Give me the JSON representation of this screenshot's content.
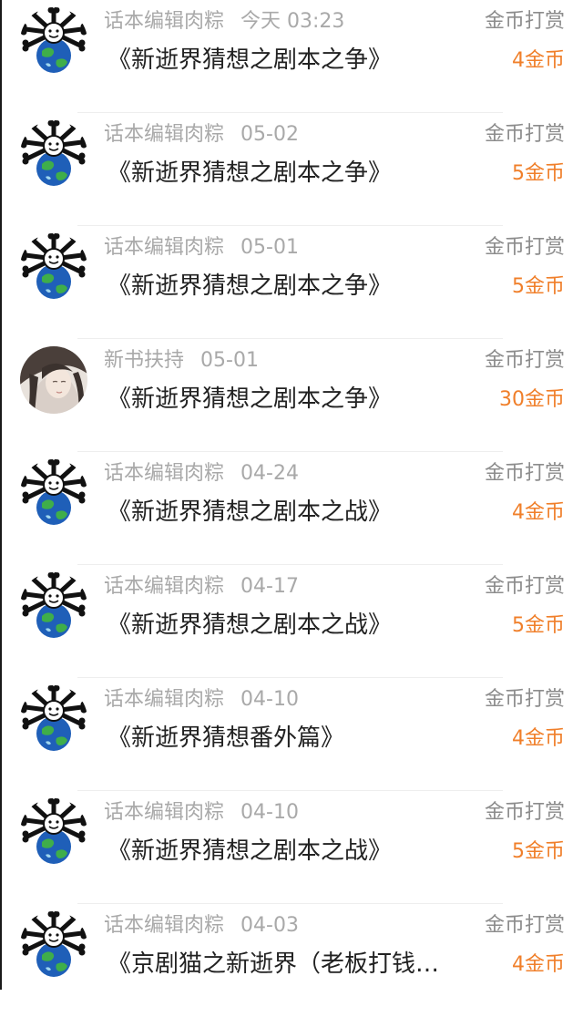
{
  "accent_color": "#f07f2a",
  "records": [
    {
      "user": "话本编辑肉粽",
      "time": "今天 03:23",
      "title": "《新逝界猜想之剧本之争》",
      "type": "金币打赏",
      "amount": "4金币",
      "avatar": "globe-avatar"
    },
    {
      "user": "话本编辑肉粽",
      "time": "05-02",
      "title": "《新逝界猜想之剧本之争》",
      "type": "金币打赏",
      "amount": "5金币",
      "avatar": "globe-avatar"
    },
    {
      "user": "话本编辑肉粽",
      "time": "05-01",
      "title": "《新逝界猜想之剧本之争》",
      "type": "金币打赏",
      "amount": "5金币",
      "avatar": "globe-avatar"
    },
    {
      "user": "新书扶持",
      "time": "05-01",
      "title": "《新逝界猜想之剧本之争》",
      "type": "金币打赏",
      "amount": "30金币",
      "avatar": "portrait-avatar"
    },
    {
      "user": "话本编辑肉粽",
      "time": "04-24",
      "title": "《新逝界猜想之剧本之战》",
      "type": "金币打赏",
      "amount": "4金币",
      "avatar": "globe-avatar"
    },
    {
      "user": "话本编辑肉粽",
      "time": "04-17",
      "title": "《新逝界猜想之剧本之战》",
      "type": "金币打赏",
      "amount": "5金币",
      "avatar": "globe-avatar"
    },
    {
      "user": "话本编辑肉粽",
      "time": "04-10",
      "title": "《新逝界猜想番外篇》",
      "type": "金币打赏",
      "amount": "4金币",
      "avatar": "globe-avatar"
    },
    {
      "user": "话本编辑肉粽",
      "time": "04-10",
      "title": "《新逝界猜想之剧本之战》",
      "type": "金币打赏",
      "amount": "5金币",
      "avatar": "globe-avatar"
    },
    {
      "user": "话本编辑肉粽",
      "time": "04-03",
      "title": "《京剧猫之新逝界（老板打钱…",
      "type": "金币打赏",
      "amount": "4金币",
      "avatar": "globe-avatar"
    }
  ]
}
